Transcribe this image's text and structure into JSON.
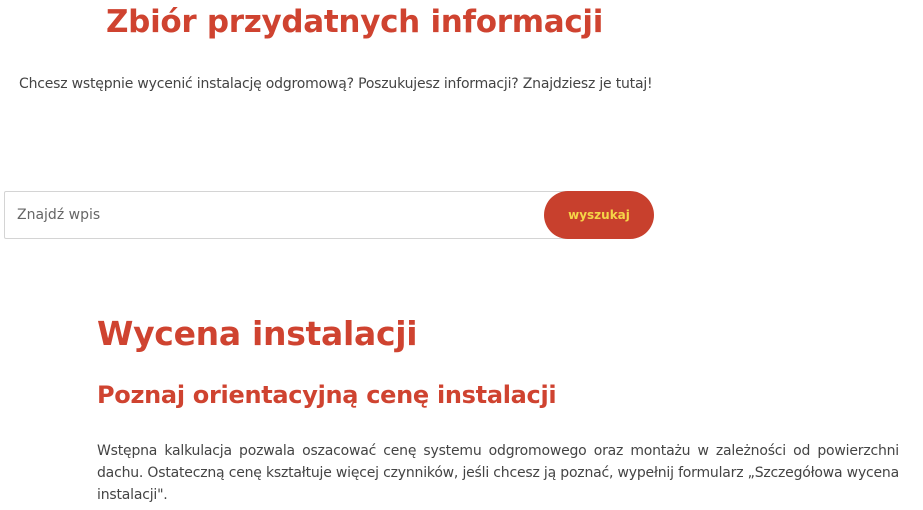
{
  "header": {
    "title": "Zbiór przydatnych informacji",
    "intro": "Chcesz wstępnie wycenić instalację odgromową? Poszukujesz informacji? Znajdziesz je tutaj!"
  },
  "search": {
    "placeholder": "Znajdź wpis",
    "value": "",
    "button_label": "wyszukaj"
  },
  "section": {
    "title": "Wycena instalacji",
    "subtitle": "Poznaj orientacyjną cenę instalacji",
    "body": "Wstępna kalkulacja pozwala oszacować cenę systemu odgromowego oraz montażu w zależności od powierzchni dachu. Ostateczną cenę kształtuje więcej czynników, jeśli chcesz ją poznać, wypełnij formularz „Szczegółowa wycena instalacji\"."
  },
  "colors": {
    "accent": "#cf4330",
    "button_bg": "#c8402d",
    "button_text": "#f5d547"
  }
}
